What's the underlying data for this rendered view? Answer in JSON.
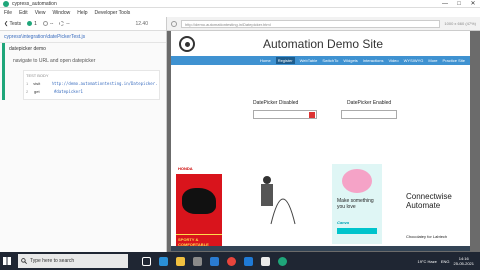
{
  "window": {
    "title": "cypress_automation",
    "controls": [
      "—",
      "□",
      "✕"
    ]
  },
  "menubar": {
    "items": [
      "File",
      "Edit",
      "View",
      "Window",
      "Help",
      "Developer Tools"
    ]
  },
  "runner": {
    "back_label": "❮ Tests",
    "passed": "1",
    "failed": "--",
    "pending": "--",
    "timer": "12.40",
    "spec_path": "cypress\\integration\\datePickerTest.js",
    "suite_title": "datepicker demo",
    "test_title": "navigate to URL and open datepicker",
    "cmd_head": "TEST BODY",
    "commands": [
      {
        "num": "1",
        "name": "visit",
        "msg": "http://demo.automationtesting.in/Datepicker.html"
      },
      {
        "num": "2",
        "name": "get",
        "msg": "#datepicker1"
      }
    ]
  },
  "aut": {
    "url": "http://demo.automationtesting.in/Datepicker.html",
    "viewport": "1000 x 660 (47%)"
  },
  "site": {
    "title": "Automation Demo Site",
    "nav": [
      "Home",
      "Register",
      "WebTable",
      "SwitchTo",
      "Widgets",
      "Interactions",
      "Video",
      "WYSIWYG",
      "More",
      "Practice Site"
    ],
    "active_nav": "Register",
    "dp_disabled_label": "DatePicker Disabled",
    "dp_enabled_label": "DatePicker Enabled"
  },
  "ads": {
    "ad1_brand": "HONDA",
    "ad1_bottom": "SPORTY & COMFORTABLE",
    "ad3_text": "Make something you love",
    "ad3_logo": "Canva",
    "ad4_title": "Connectwise Automate",
    "ad4_sub": "Chocolatey for Labtech"
  },
  "taskbar": {
    "search_placeholder": "Type here to search",
    "tray_weather": "19°C Haze",
    "tray_lang": "ENG",
    "time": "14:16",
    "date": "25-05-2021"
  }
}
